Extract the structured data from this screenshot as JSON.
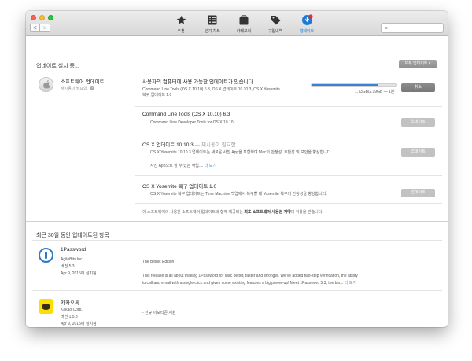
{
  "toolbar": {
    "nav_back": "<",
    "nav_forward": ">",
    "tabs": [
      {
        "label": "추천",
        "icon": "star-icon"
      },
      {
        "label": "인기 차트",
        "icon": "list-icon"
      },
      {
        "label": "카테고리",
        "icon": "categories-icon"
      },
      {
        "label": "구입내역",
        "icon": "tag-icon"
      },
      {
        "label": "업데이트",
        "icon": "updates-icon",
        "active": true
      }
    ],
    "search_placeholder": ""
  },
  "installing": {
    "title": "업데이트 설치 중...",
    "all_button": "모두 업데이트 ▾",
    "software_title": "소프트웨어 업데이트",
    "software_sub": "재시동이 필요함",
    "main_text": "사용자의 컴퓨터에 사용 가능한 업데이트가 있습니다.",
    "main_detail_1": "Command Line Tools (OS X 10.10) 6.3, OS X 업데이트 10.10.3, OS X Yosemite",
    "main_detail_2": "복구 업데이트 1.0",
    "progress_text": "1.73GB/2.19GB — 1분",
    "progress_fraction": 0.79,
    "cancel_label": "취소",
    "items": [
      {
        "title": "Command Line Tools (OS X 10.10) 6.3",
        "title_suffix": "",
        "desc": "Command Line Developer Tools for OS X 10.10",
        "desc2": "",
        "button": "업데이트"
      },
      {
        "title": "OS X 업데이트 10.10.3",
        "title_suffix": "— 재시동이 필요함",
        "desc": "OS X Yosemite 10.10.3 업데이트는 새로운 사진 App을 포함하며 Mac의 안정성, 호환성 및 보안을 향상합니다.",
        "desc2": "사진 App으로 할 수 있는 작업.... ",
        "more": "더 보기",
        "button": "업데이트"
      },
      {
        "title": "OS X Yosemite 복구 업데이트 1.0",
        "title_suffix": "",
        "desc": "OS X Yosemite 복구 업데이트는 Time Machine 백업에서 복구할 때 Yosemite 복구의 안정성을 향상합니다.",
        "desc2": "",
        "button": "업데이트"
      }
    ],
    "license_note_prefix": "이 소프트웨어의 사용은 소프트웨어 업데이트와 함께 제공되는 ",
    "license_note_bold": "최초 소프트웨어 사용권 계약",
    "license_note_suffix": "의 적용을 받습니다."
  },
  "recent": {
    "title": "최근 30일 동안 업데이트된 항목",
    "apps": [
      {
        "name": "1Password",
        "vendor": "AgileBits Inc.",
        "version": "버전 5.3",
        "date": "Apr 9, 2015에 설치됨",
        "headline": "The Bionic Edition",
        "desc1": "This release is all about making 1Password for Mac better, faster and stronger. We've added two-step verification, the ability",
        "desc2": "to call and email with a single click and given some existing features a big power-up! Meet 1Password 5.3, the bio... ",
        "more": "더 보기"
      },
      {
        "name": "카카오톡",
        "vendor": "Kakao Corp.",
        "version": "버전 1.5.3",
        "date": "Apr 9, 2015에 설치됨",
        "headline": "",
        "desc1": "- 신규 이모티콘 지원",
        "desc2": "",
        "more": ""
      }
    ]
  },
  "colors": {
    "accent": "#1b7bd7",
    "progress": "#3b82d6",
    "link": "#4a8ed8"
  }
}
